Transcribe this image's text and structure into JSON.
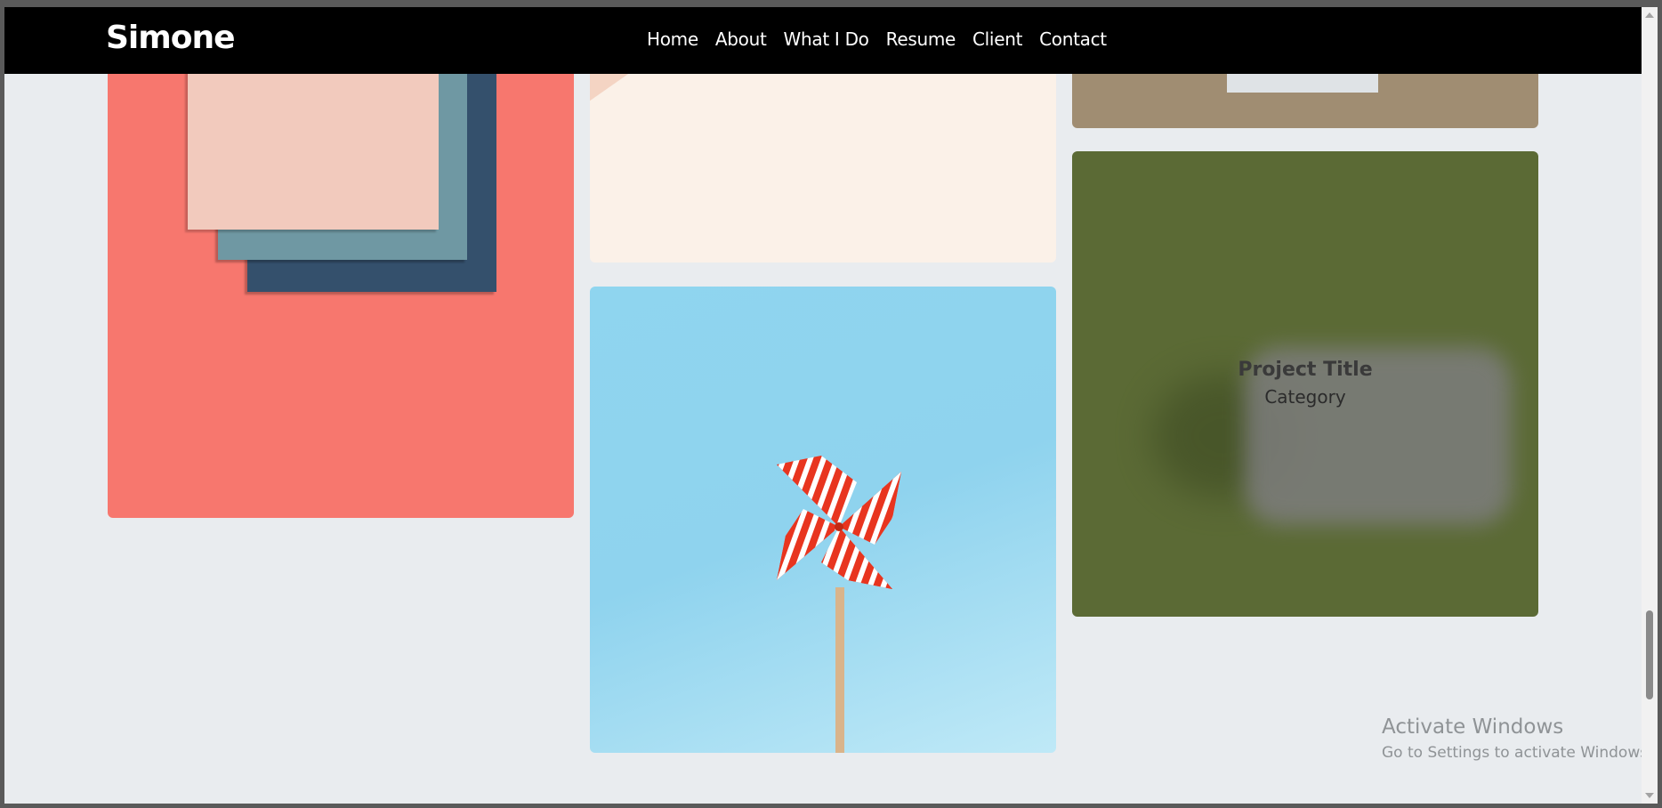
{
  "navbar": {
    "brand": "Simone",
    "links": [
      "Home",
      "About",
      "What I Do",
      "Resume",
      "Client",
      "Contact"
    ]
  },
  "portfolio": {
    "hover_item": {
      "title": "Project Title",
      "category": "Category"
    }
  },
  "watermark": {
    "title": "Activate Windows",
    "subtitle": "Go to Settings to activate Windows."
  },
  "colors": {
    "navbar_bg": "#000000",
    "page_bg": "#e9ecef",
    "coral_tile": "#f7776e",
    "blue_tile": "#8fd5ef",
    "green_tile": "#5b6a35"
  }
}
